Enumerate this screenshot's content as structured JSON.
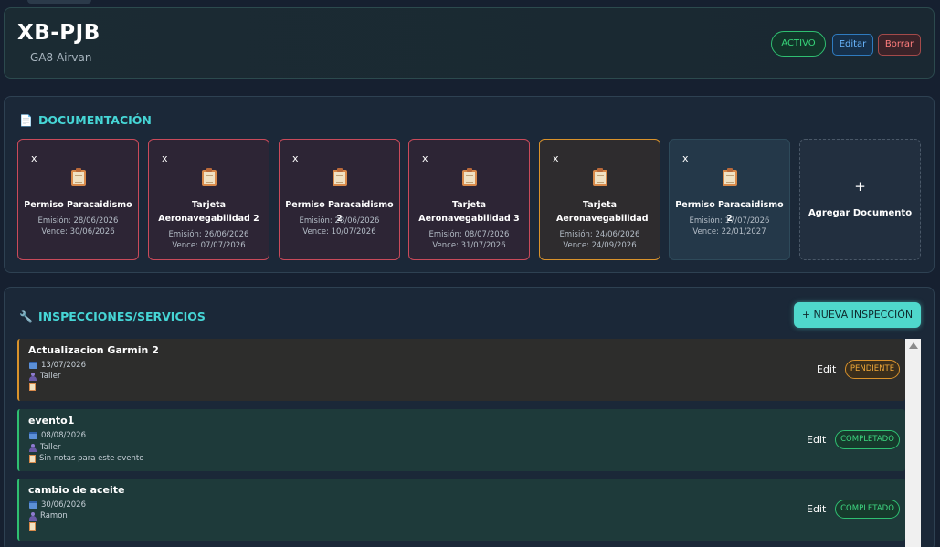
{
  "aircraft": {
    "registration": "XB-PJB",
    "model": "GA8 Airvan",
    "status_label": "ACTIVO",
    "edit_label": "Editar",
    "delete_label": "Borrar"
  },
  "documentation": {
    "title": "DOCUMENTACIÓN",
    "icon": "document-icon",
    "delete_symbol": "x",
    "documents": [
      {
        "name": "Permiso Paracaidismo",
        "issued": "Emisión: 28/06/2026",
        "expires": "Vence: 30/06/2026",
        "state": "expired"
      },
      {
        "name": "Tarjeta Aeronavegabilidad 2",
        "issued": "Emisión: 26/06/2026",
        "expires": "Vence: 07/07/2026",
        "state": "expired"
      },
      {
        "name": "Permiso Paracaidismo 2",
        "issued": "Emisión: 28/06/2026",
        "expires": "Vence: 10/07/2026",
        "state": "expired"
      },
      {
        "name": "Tarjeta Aeronavegabilidad 3",
        "issued": "Emisión: 08/07/2026",
        "expires": "Vence: 31/07/2026",
        "state": "expired"
      },
      {
        "name": "Tarjeta Aeronavegabilidad",
        "issued": "Emisión: 24/06/2026",
        "expires": "Vence: 24/09/2026",
        "state": "warning"
      },
      {
        "name": "Permiso Paracaidismo 2",
        "issued": "Emisión: 17/07/2026",
        "expires": "Vence: 22/01/2027",
        "state": "ok"
      }
    ],
    "add_symbol": "+",
    "add_label": "Agregar Documento"
  },
  "inspections": {
    "title": "INSPECCIONES/SERVICIOS",
    "icon": "wrench-icon",
    "new_button_label": "+ NUEVA INSPECCIÓN",
    "edit_label": "Edit",
    "items": [
      {
        "title": "Actualizacion Garmin 2",
        "date": "13/07/2026",
        "person": "Taller",
        "notes": "",
        "status": "PENDIENTE"
      },
      {
        "title": "evento1",
        "date": "08/08/2026",
        "person": "Taller",
        "notes": "Sin notas para este evento",
        "status": "COMPLETADO"
      },
      {
        "title": "cambio de aceite",
        "date": "30/06/2026",
        "person": "Ramon",
        "notes": "",
        "status": "COMPLETADO"
      }
    ]
  },
  "colors": {
    "accent": "#46d6d6",
    "expired": "#c94a5a",
    "warning": "#d9922b",
    "ok": "#2fbf71"
  }
}
